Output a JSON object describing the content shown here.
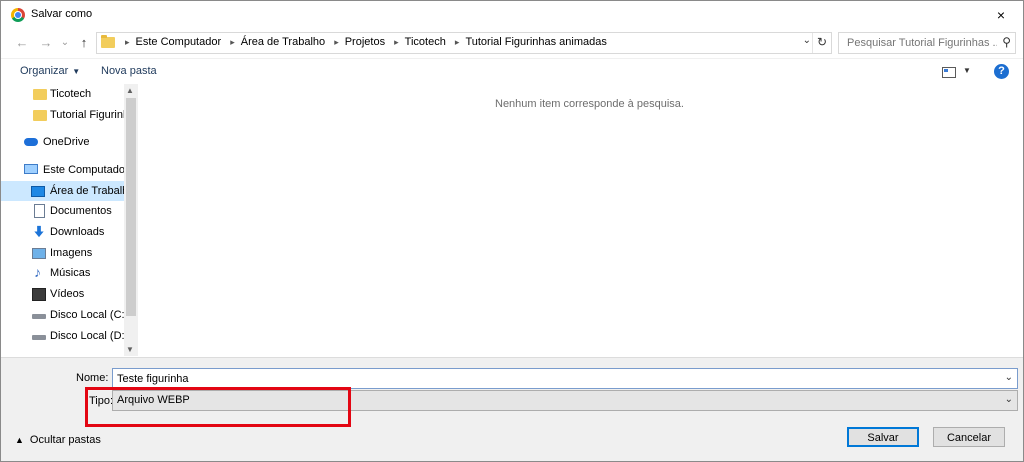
{
  "window": {
    "title": "Salvar como",
    "close_icon": "×"
  },
  "nav": {
    "back_icon": "←",
    "forward_icon": "→",
    "history_icon": "⌄",
    "up_icon": "↑",
    "breadcrumbs": [
      "Este Computador",
      "Área de Trabalho",
      "Projetos",
      "Ticotech",
      "Tutorial Figurinhas animadas"
    ],
    "dropdown_icon": "⌄",
    "refresh_icon": "↻",
    "search_placeholder": "Pesquisar Tutorial Figurinhas ...",
    "search_icon": "⚲"
  },
  "toolbar": {
    "organize_label": "Organizar",
    "new_folder_label": "Nova pasta",
    "help_label": "?"
  },
  "sidebar": {
    "items": [
      {
        "label": "Ticotech",
        "icon": "folder-icon"
      },
      {
        "label": "Tutorial Figurinhas",
        "icon": "folder-icon"
      },
      {
        "label": "OneDrive",
        "icon": "onedrive-icon"
      },
      {
        "label": "Este Computador",
        "icon": "computer-icon"
      },
      {
        "label": "Área de Trabalho",
        "icon": "desktop-icon",
        "selected": true
      },
      {
        "label": "Documentos",
        "icon": "documents-icon"
      },
      {
        "label": "Downloads",
        "icon": "downloads-icon"
      },
      {
        "label": "Imagens",
        "icon": "pictures-icon"
      },
      {
        "label": "Músicas",
        "icon": "music-icon"
      },
      {
        "label": "Vídeos",
        "icon": "videos-icon"
      },
      {
        "label": "Disco Local (C:)",
        "icon": "drive-icon"
      },
      {
        "label": "Disco Local (D:)",
        "icon": "drive-icon"
      }
    ]
  },
  "content": {
    "empty_message": "Nenhum item corresponde à pesquisa."
  },
  "form": {
    "name_label": "Nome:",
    "name_value": "Teste figurinha",
    "type_label": "Tipo:",
    "type_value": "Arquivo WEBP",
    "highlight_color": "#e30613"
  },
  "footer": {
    "hide_folders_label": "Ocultar pastas",
    "save_label": "Salvar",
    "cancel_label": "Cancelar"
  }
}
